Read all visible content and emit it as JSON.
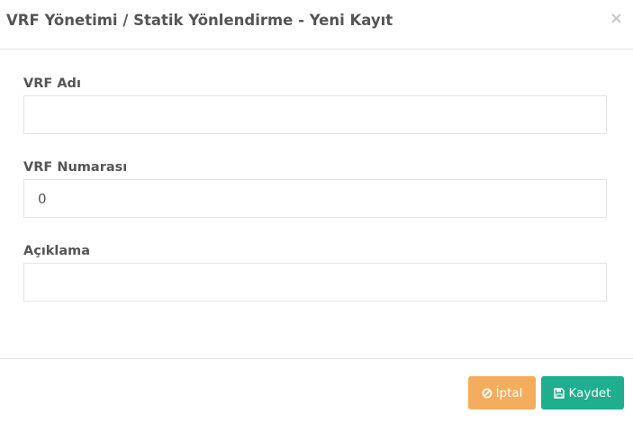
{
  "modal": {
    "title": "VRF Yönetimi / Statik Yönlendirme - Yeni Kayıt",
    "close_symbol": "×"
  },
  "form": {
    "vrf_name": {
      "label": "VRF Adı",
      "value": "",
      "placeholder": ""
    },
    "vrf_number": {
      "label": "VRF Numarası",
      "value": "0",
      "placeholder": ""
    },
    "description": {
      "label": "Açıklama",
      "value": "",
      "placeholder": ""
    }
  },
  "footer": {
    "cancel_label": "İptal",
    "cancel_icon": "ban-icon",
    "save_label": "Kaydet",
    "save_icon": "floppy-disk-icon"
  },
  "colors": {
    "cancel": "#f4ad5c",
    "save": "#1fae8e",
    "text": "#555555",
    "border": "#e3e3e3"
  }
}
